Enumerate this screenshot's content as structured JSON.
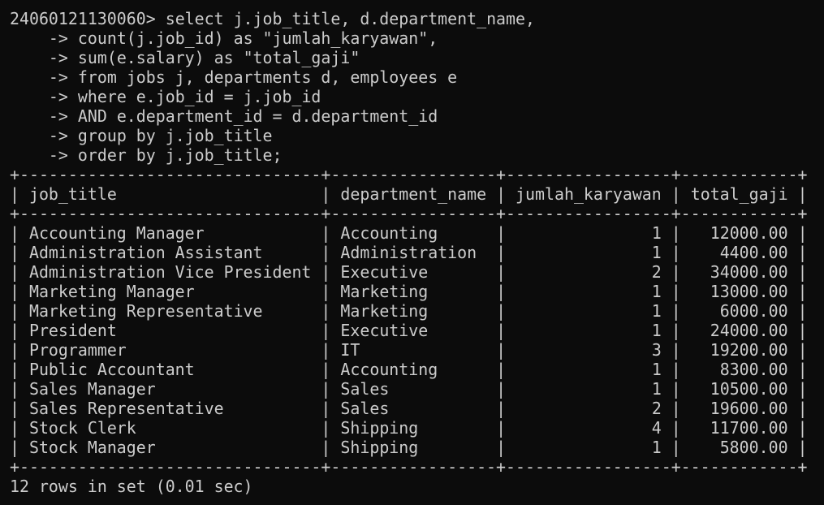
{
  "terminal": {
    "prompt": "24060121130060>",
    "query_lines": [
      "select j.job_title, d.department_name,",
      "count(j.job_id) as \"jumlah_karyawan\",",
      "sum(e.salary) as \"total_gaji\"",
      "from jobs j, departments d, employees e",
      "where e.job_id = j.job_id",
      "AND e.department_id = d.department_id",
      "group by j.job_title",
      "order by j.job_title;"
    ],
    "continuation_prompt": "->"
  },
  "result": {
    "columns": [
      "job_title",
      "department_name",
      "jumlah_karyawan",
      "total_gaji"
    ],
    "rows": [
      [
        "Accounting Manager",
        "Accounting",
        "1",
        "12000.00"
      ],
      [
        "Administration Assistant",
        "Administration",
        "1",
        "4400.00"
      ],
      [
        "Administration Vice President",
        "Executive",
        "2",
        "34000.00"
      ],
      [
        "Marketing Manager",
        "Marketing",
        "1",
        "13000.00"
      ],
      [
        "Marketing Representative",
        "Marketing",
        "1",
        "6000.00"
      ],
      [
        "President",
        "Executive",
        "1",
        "24000.00"
      ],
      [
        "Programmer",
        "IT",
        "3",
        "19200.00"
      ],
      [
        "Public Accountant",
        "Accounting",
        "1",
        "8300.00"
      ],
      [
        "Sales Manager",
        "Sales",
        "1",
        "10500.00"
      ],
      [
        "Sales Representative",
        "Sales",
        "2",
        "19600.00"
      ],
      [
        "Stock Clerk",
        "Shipping",
        "4",
        "11700.00"
      ],
      [
        "Stock Manager",
        "Shipping",
        "1",
        "5800.00"
      ]
    ],
    "summary": "12 rows in set (0.01 sec)"
  },
  "colors": {
    "background": "#0c0c0c",
    "foreground": "#cccccc"
  }
}
